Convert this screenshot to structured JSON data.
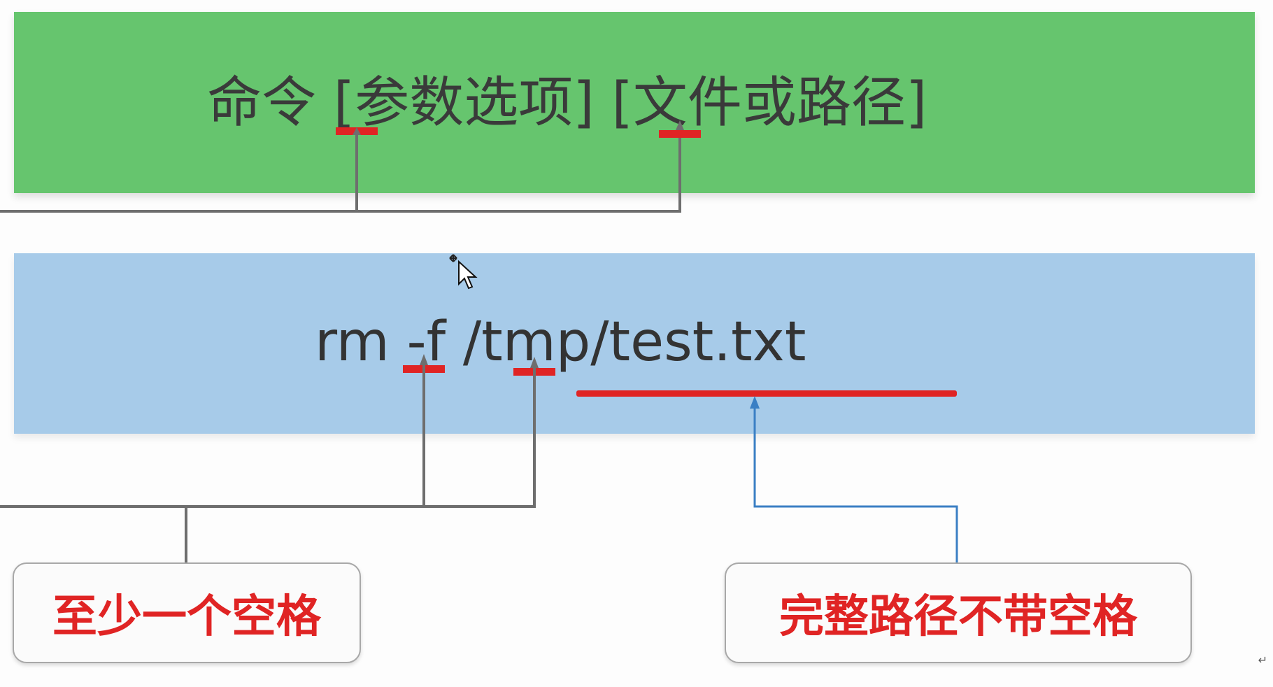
{
  "syntax_text": "命令 [参数选项] [文件或路径]",
  "example_text": "rm -f /tmp/test.txt",
  "callouts": {
    "spaces": "至少一个空格",
    "path": "完整路径不带空格"
  },
  "colors": {
    "green_band": "#66c56e",
    "blue_band": "#a7cbe9",
    "marker_red": "#e02424",
    "connector_gray": "#6e6e6e",
    "connector_blue": "#3a7fc4"
  },
  "icons": {
    "cursor": "move-cursor-icon",
    "return": "return-mark-icon"
  }
}
